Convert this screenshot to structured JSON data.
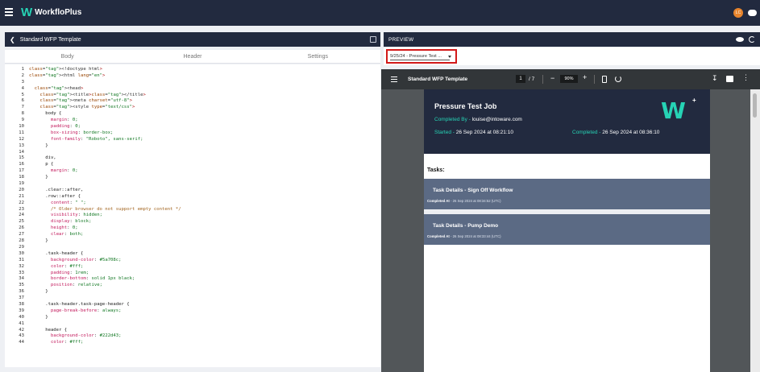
{
  "app": {
    "brand": "WorkfloPlus",
    "logo_mark": "W",
    "avatar_initials": "LC"
  },
  "editor": {
    "template_name": "Standard WFP Template",
    "tabs": [
      "Body",
      "Header",
      "Settings"
    ],
    "lines": [
      {
        "n": "1",
        "t": "<!doctype html>"
      },
      {
        "n": "2",
        "t": "<html lang=\"en\">"
      },
      {
        "n": "3",
        "t": ""
      },
      {
        "n": "4",
        "t": "  <head>"
      },
      {
        "n": "5",
        "t": "    <title></title>"
      },
      {
        "n": "6",
        "t": "    <meta charset=\"utf-8\">"
      },
      {
        "n": "7",
        "t": "    <style type=\"text/css\">"
      },
      {
        "n": "8",
        "t": "      body {"
      },
      {
        "n": "9",
        "t": "        margin: 0;"
      },
      {
        "n": "10",
        "t": "        padding: 0;"
      },
      {
        "n": "11",
        "t": "        box-sizing: border-box;"
      },
      {
        "n": "12",
        "t": "        font-family: \"Roboto\", sans-serif;"
      },
      {
        "n": "13",
        "t": "      }"
      },
      {
        "n": "14",
        "t": ""
      },
      {
        "n": "15",
        "t": "      div,"
      },
      {
        "n": "16",
        "t": "      p {"
      },
      {
        "n": "17",
        "t": "        margin: 0;"
      },
      {
        "n": "18",
        "t": "      }"
      },
      {
        "n": "19",
        "t": ""
      },
      {
        "n": "20",
        "t": "      .clear::after,"
      },
      {
        "n": "21",
        "t": "      .row::after {"
      },
      {
        "n": "22",
        "t": "        content: \" \";"
      },
      {
        "n": "23",
        "t": "        /* Older browser do not support empty content */"
      },
      {
        "n": "24",
        "t": "        visibility: hidden;"
      },
      {
        "n": "25",
        "t": "        display: block;"
      },
      {
        "n": "26",
        "t": "        height: 0;"
      },
      {
        "n": "27",
        "t": "        clear: both;"
      },
      {
        "n": "28",
        "t": "      }"
      },
      {
        "n": "29",
        "t": ""
      },
      {
        "n": "30",
        "t": "      .task-header {"
      },
      {
        "n": "31",
        "t": "        background-color: #5a708c;"
      },
      {
        "n": "32",
        "t": "        color: #fff;"
      },
      {
        "n": "33",
        "t": "        padding: 1rem;"
      },
      {
        "n": "34",
        "t": "        border-bottom: solid 1px black;"
      },
      {
        "n": "35",
        "t": "        position: relative;"
      },
      {
        "n": "36",
        "t": "      }"
      },
      {
        "n": "37",
        "t": ""
      },
      {
        "n": "38",
        "t": "      .task-header.task-page-header {"
      },
      {
        "n": "39",
        "t": "        page-break-before: always;"
      },
      {
        "n": "40",
        "t": "      }"
      },
      {
        "n": "41",
        "t": ""
      },
      {
        "n": "42",
        "t": "      header {"
      },
      {
        "n": "43",
        "t": "        background-color: #222d43;"
      },
      {
        "n": "44",
        "t": "        color: #fff;"
      }
    ]
  },
  "preview": {
    "label": "PREVIEW",
    "job_select": "9/25/24 - Pressure Test ...",
    "pdf": {
      "title": "Standard WFP Template",
      "page": "1",
      "page_total": "/ 7",
      "zoom": "90%"
    },
    "job": {
      "title": "Pressure Test Job",
      "completed_by_label": "Completed By - ",
      "completed_by": "louise@intoware.com",
      "started_label": "Started - ",
      "started": "26 Sep 2024 at 08:21:10",
      "completed_label": "Completed - ",
      "completed": "26 Sep 2024 at 08:36:10",
      "logo_plus": "+"
    },
    "tasks_label": "Tasks:",
    "tasks": [
      {
        "title": "Task Details - Sign Off Workflow",
        "completed_at_label": "Completed At",
        "completed_at": " - 26 Sep 2024 at 08:34:52 (UTC)"
      },
      {
        "title": "Task Details - Pump Demo",
        "completed_at_label": "Completed At",
        "completed_at": " - 26 Sep 2024 at 08:33:44 (UTC)"
      }
    ]
  },
  "colors": {
    "navy": "#222a3f",
    "accent": "#26d3b5",
    "task_bg": "#5b6a84",
    "highlight": "#d21919"
  }
}
